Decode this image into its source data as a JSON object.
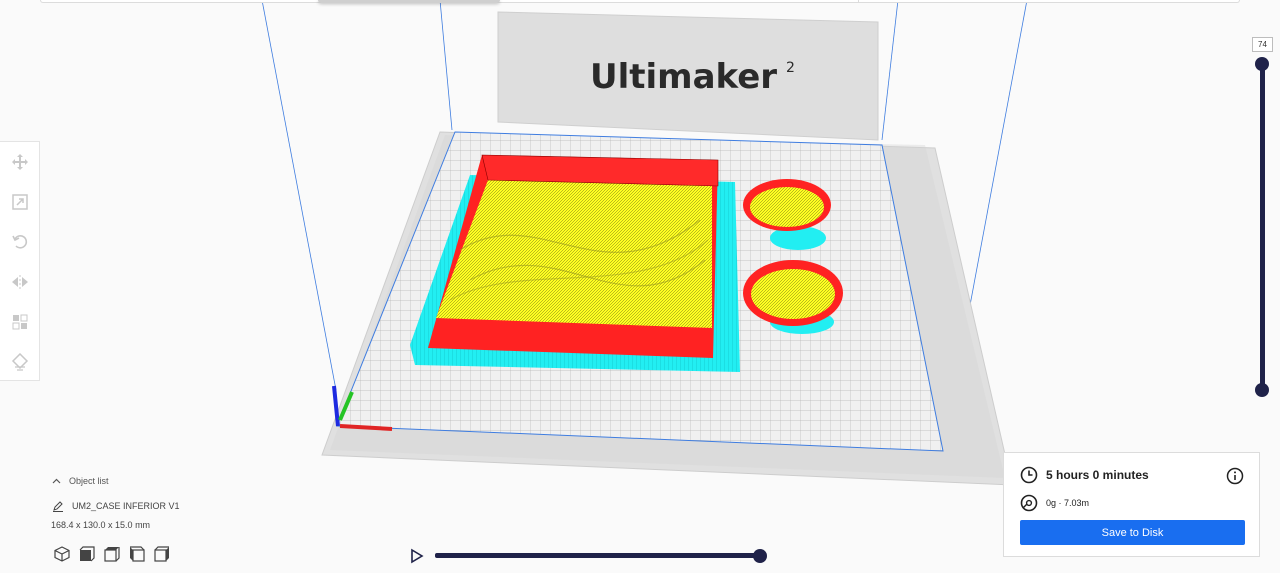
{
  "printer": {
    "brand": "Ultimaker",
    "model_superscript": "2"
  },
  "layer_slider": {
    "current_layer": "74"
  },
  "object_list": {
    "toggle_label": "Object list",
    "object_name": "UM2_CASE INFERIOR V1",
    "dimensions": "168.4 x 130.0 x 15.0 mm"
  },
  "toolbar": {
    "tools": [
      "move-icon",
      "scale-icon",
      "rotate-icon",
      "mirror-icon",
      "per-model-settings-icon",
      "support-blocker-icon"
    ]
  },
  "view_buttons": [
    "3d-view-icon",
    "front-view-icon",
    "top-view-icon",
    "left-view-icon",
    "right-view-icon"
  ],
  "simulation": {
    "progress": 1.0
  },
  "print_info": {
    "time": "5 hours 0 minutes",
    "material": "0g · 7.03m",
    "save_label": "Save to Disk"
  },
  "colors": {
    "accent": "#196ef0",
    "slider": "#1f2249",
    "wall_outer": "#ff2020",
    "infill": "#ffff22",
    "skirt": "#22f0f0"
  }
}
